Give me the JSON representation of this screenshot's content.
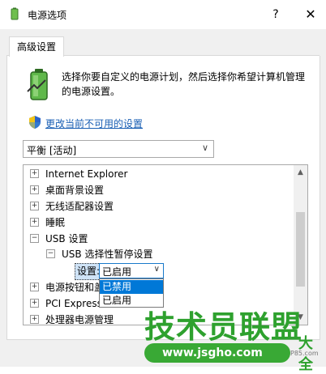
{
  "window": {
    "title": "电源选项",
    "help_label": "?",
    "close_label": "✕"
  },
  "tabs": [
    {
      "label": "高级设置"
    }
  ],
  "intro": {
    "description": "选择你要自定义的电源计划，然后选择你希望计算机管理的电源设置。",
    "change_link": "更改当前不可用的设置"
  },
  "plan_select": {
    "value": "平衡 [活动]"
  },
  "tree": {
    "items": [
      {
        "label": "Internet Explorer",
        "expander": "⊞"
      },
      {
        "label": "桌面背景设置",
        "expander": "⊞"
      },
      {
        "label": "无线适配器设置",
        "expander": "⊞"
      },
      {
        "label": "睡眠",
        "expander": "⊞"
      },
      {
        "label": "USB 设置",
        "expander": "⊟"
      },
      {
        "label": "USB 选择性暂停设置",
        "expander": "⊟"
      },
      {
        "label": "电源按钮和盖",
        "expander": "⊞"
      },
      {
        "label": "PCI Express",
        "expander": "⊞"
      },
      {
        "label": "处理器电源管理",
        "expander": "⊞"
      }
    ],
    "setting_label": "设置:",
    "setting_value": "已启用",
    "dropdown_options": [
      "已禁用",
      "已启用"
    ],
    "dropdown_selected_index": 0
  },
  "watermark": {
    "text": "技术员联盟",
    "suffix": "大全",
    "url": "www.jsgho.com",
    "small": "P85.com"
  },
  "colors": {
    "link": "#1a5fb4",
    "selection": "#0078d7",
    "watermark_green": "#2ea12e"
  }
}
